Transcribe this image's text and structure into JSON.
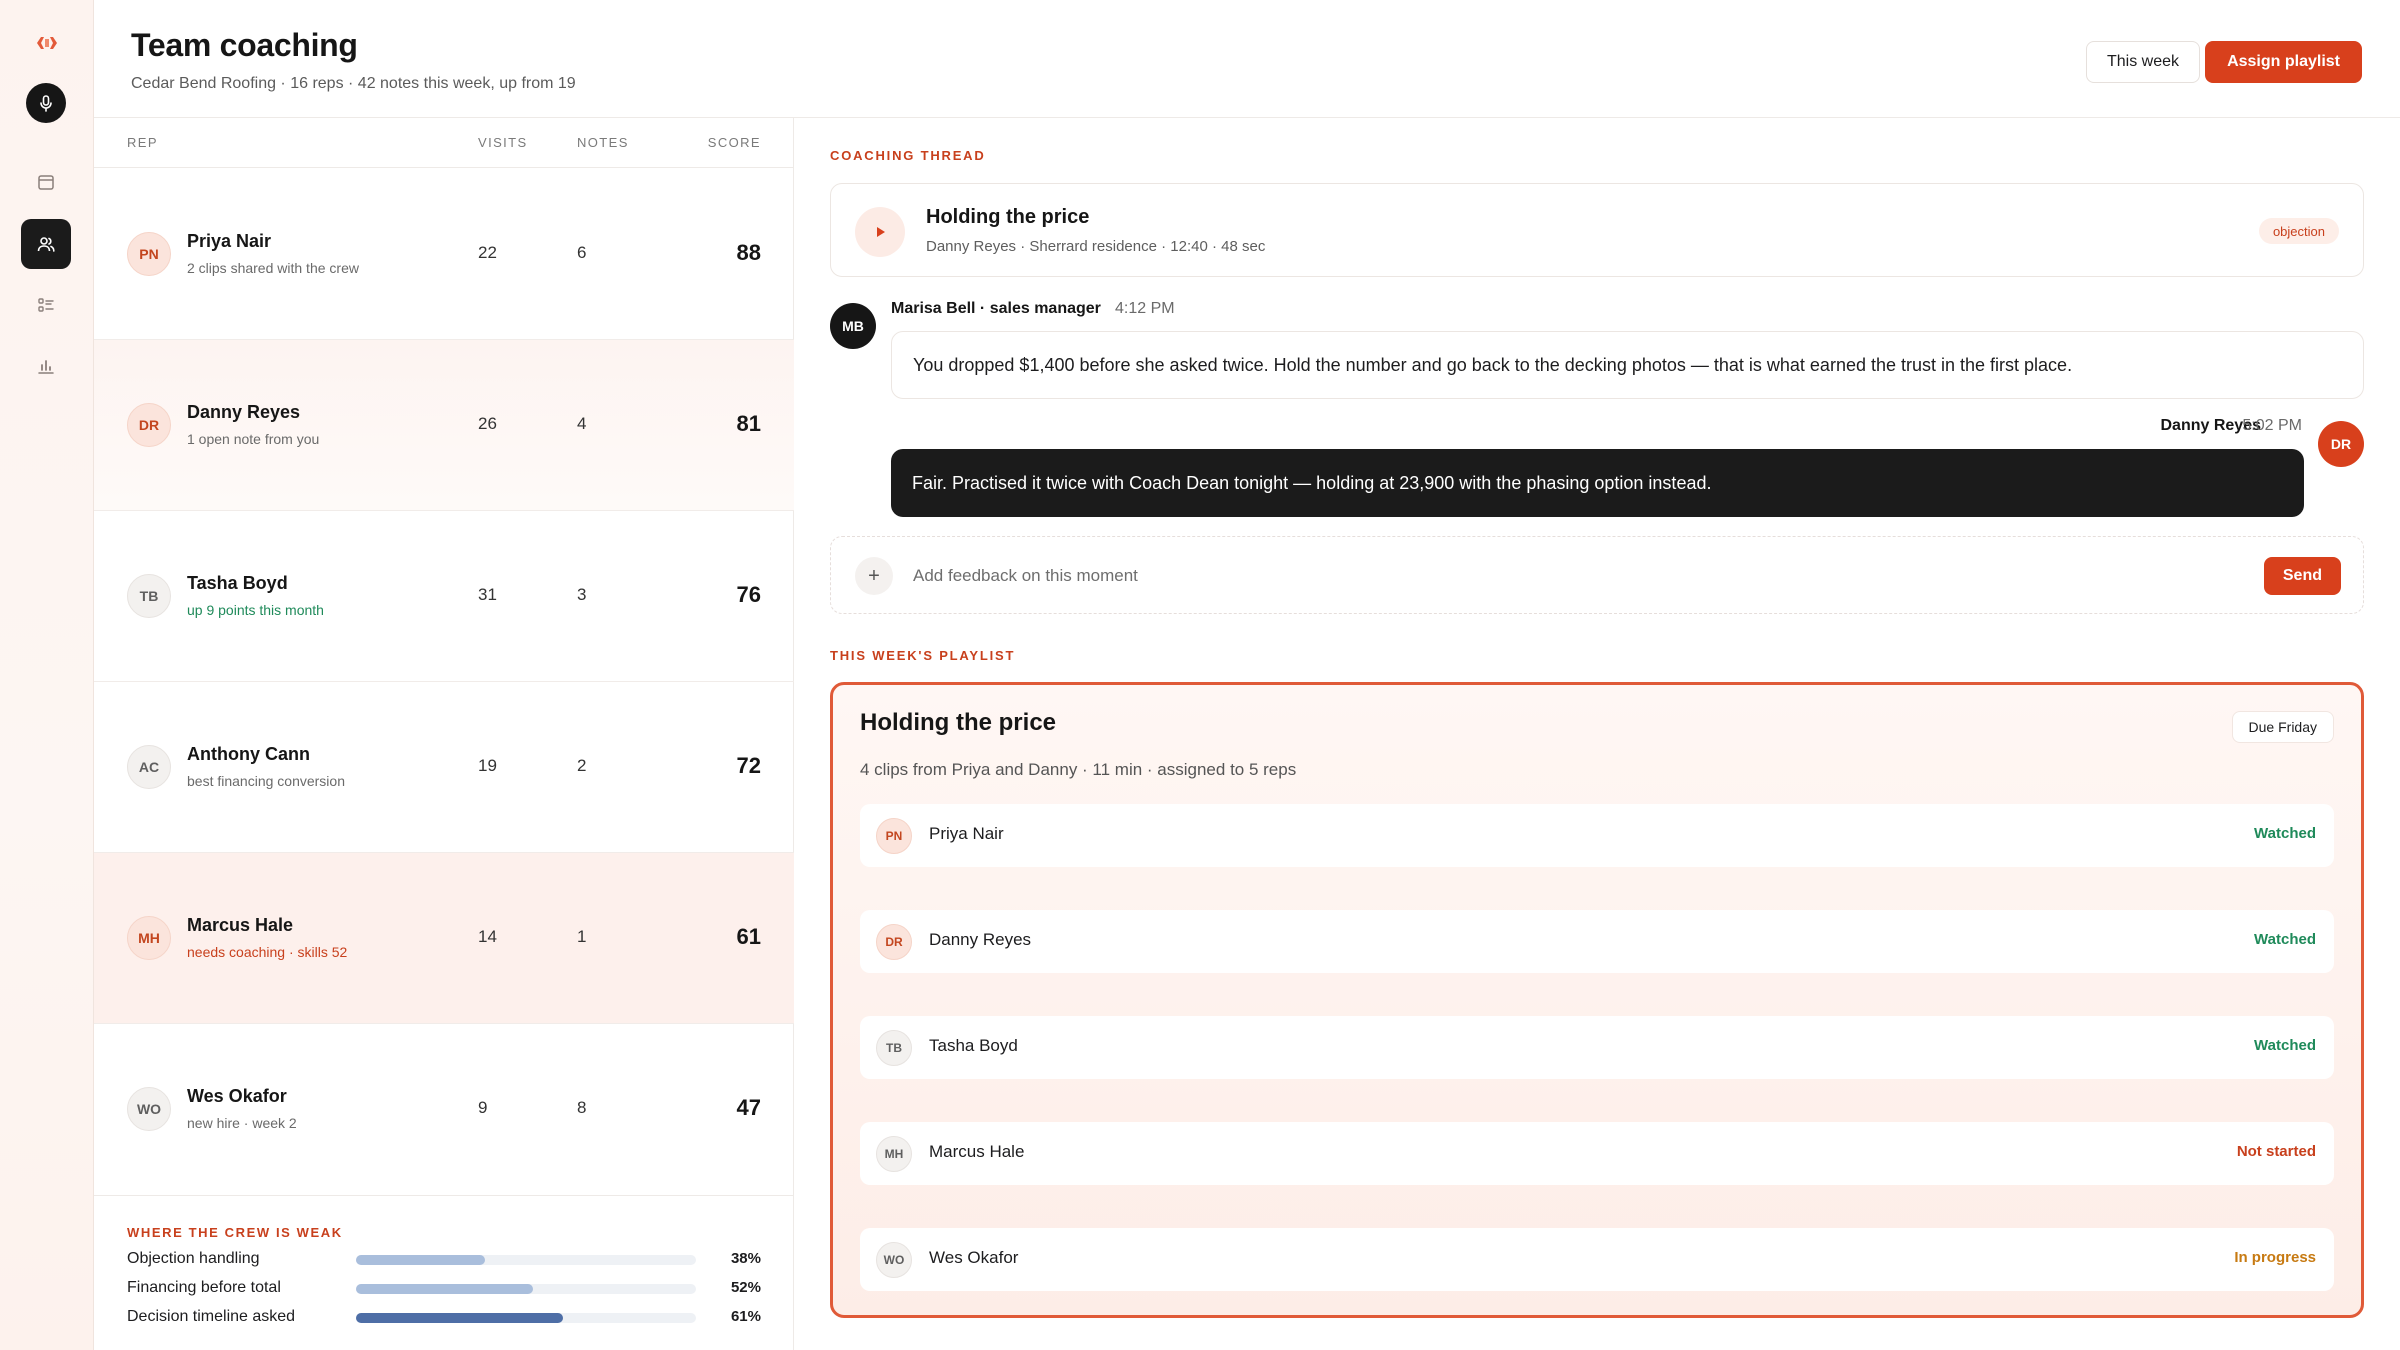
{
  "app": {
    "title": "Team coaching",
    "subtitle": "Cedar Bend Roofing · 16 reps · 42 notes this week, up from 19"
  },
  "sidebar": {
    "items": [
      {
        "icon": "logo-icon"
      },
      {
        "icon": "microphone-icon"
      },
      {
        "icon": "calendar-icon"
      },
      {
        "icon": "team-icon",
        "active": true
      },
      {
        "icon": "checklist-icon"
      },
      {
        "icon": "bar-chart-icon"
      }
    ]
  },
  "header": {
    "period_button": "This week",
    "assign_button": "Assign playlist"
  },
  "reps": {
    "columns": [
      "REP",
      "VISITS",
      "NOTES",
      "SCORE"
    ],
    "rows": [
      {
        "initials": "PN",
        "name": "Priya Nair",
        "sub": "2 clips shared with the crew",
        "visits": "22",
        "notes": "6",
        "score": "88"
      },
      {
        "initials": "DR",
        "name": "Danny Reyes",
        "sub": "1 open note from you",
        "visits": "26",
        "notes": "4",
        "score": "81"
      },
      {
        "initials": "TB",
        "name": "Tasha Boyd",
        "sub": "up 9 points this month",
        "visits": "31",
        "notes": "3",
        "score": "76"
      },
      {
        "initials": "AC",
        "name": "Anthony Cann",
        "sub": "best financing conversion",
        "visits": "19",
        "notes": "2",
        "score": "72"
      },
      {
        "initials": "MH",
        "name": "Marcus Hale",
        "sub": "needs coaching · skills 52",
        "visits": "14",
        "notes": "1",
        "score": "61"
      },
      {
        "initials": "WO",
        "name": "Wes Okafor",
        "sub": "new hire · week 2",
        "visits": "9",
        "notes": "8",
        "score": "47"
      }
    ]
  },
  "weak": {
    "title": "WHERE THE CREW IS WEAK",
    "items": [
      {
        "label": "Objection handling",
        "pct_label": "38%",
        "value": 0.38,
        "color": "#a9bedc"
      },
      {
        "label": "Financing before total",
        "pct_label": "52%",
        "value": 0.52,
        "color": "#a9bedc"
      },
      {
        "label": "Decision timeline asked",
        "pct_label": "61%",
        "value": 0.61,
        "color": "#4e6ea6"
      }
    ]
  },
  "thread": {
    "section_label": "COACHING THREAD",
    "clip": {
      "title": "Holding the price",
      "meta": "Danny Reyes · Sherrard residence · 12:40 · 48 sec",
      "tag": "objection"
    },
    "message": {
      "initials": "MB",
      "author": "Marisa Bell · sales manager",
      "time": "4:12 PM",
      "text": "You dropped $1,400 before she asked twice. Hold the number and go back to the decking photos — that is what earned the trust in the first place."
    },
    "reply": {
      "initials": "DR",
      "author": "Danny Reyes",
      "time": "5:02 PM",
      "text": "Fair. Practised it twice with Coach Dean tonight — holding at 23,900 with the phasing option instead."
    },
    "composer": {
      "placeholder": "Add feedback on this moment",
      "send": "Send"
    }
  },
  "playlist": {
    "section_label": "THIS WEEK'S PLAYLIST",
    "title": "Holding the price",
    "due": "Due Friday",
    "meta": "4 clips from Priya and Danny · 11 min · assigned to 5 reps",
    "rows": [
      {
        "initials": "PN",
        "name": "Priya Nair",
        "status": "Watched",
        "status_color": "#1f8a5a"
      },
      {
        "initials": "DR",
        "name": "Danny Reyes",
        "status": "Watched",
        "status_color": "#1f8a5a"
      },
      {
        "initials": "TB",
        "name": "Tasha Boyd",
        "status": "Watched",
        "status_color": "#1f8a5a"
      },
      {
        "initials": "MH",
        "name": "Marcus Hale",
        "status": "Not started",
        "status_color": "#c8401d"
      },
      {
        "initials": "WO",
        "name": "Wes Okafor",
        "status": "In progress",
        "status_color": "#c77a12"
      }
    ]
  }
}
